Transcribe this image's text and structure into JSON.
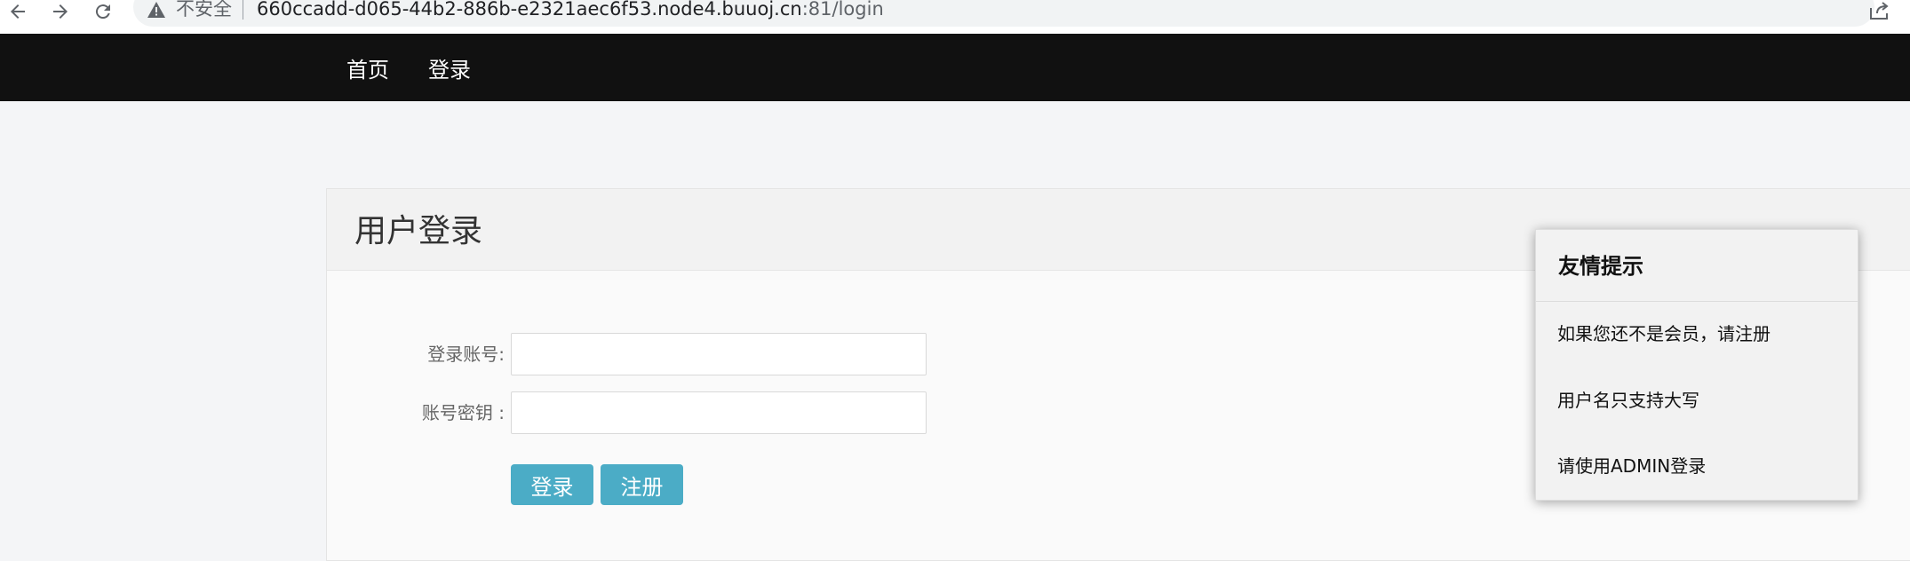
{
  "browser": {
    "security_label": "不安全",
    "url_host": "660ccadd-d065-44b2-886b-e2321aec6f53.node4.buuoj.cn",
    "url_rest": ":81/login",
    "icons": [
      "back-arrow-icon",
      "forward-arrow-icon",
      "reload-icon",
      "warning-icon",
      "share-icon"
    ]
  },
  "navbar": {
    "items": [
      {
        "label": "首页"
      },
      {
        "label": "登录"
      }
    ],
    "background": "#111111"
  },
  "login": {
    "title": "用户登录",
    "account_label": "登录账号:",
    "account_value": "",
    "password_label": "账号密钥 :",
    "password_value": "",
    "login_button": "登录",
    "register_button": "注册",
    "button_color": "#4bacc6"
  },
  "tips": {
    "title": "友情提示",
    "items": [
      {
        "text": "如果您还不是会员，请注册"
      },
      {
        "text": "用户名只支持大写"
      },
      {
        "text": "请使用ADMIN登录"
      }
    ]
  }
}
